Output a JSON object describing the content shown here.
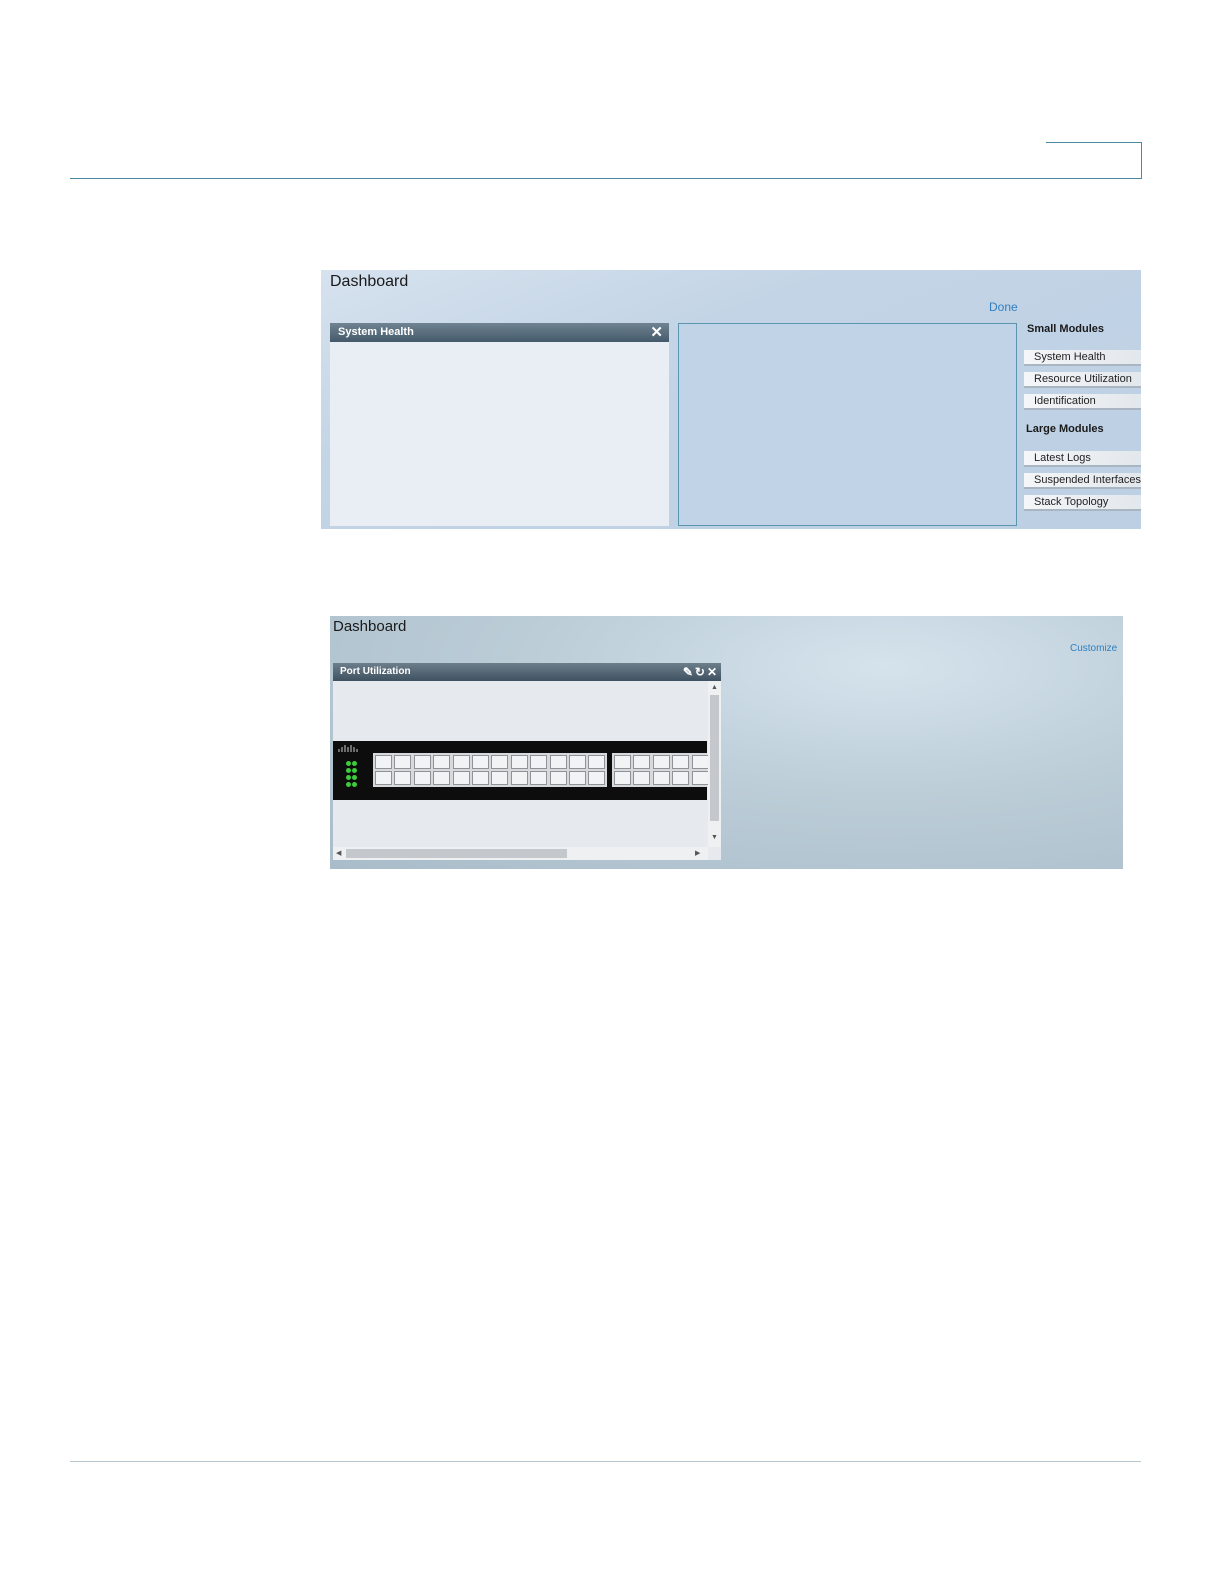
{
  "screenshot1": {
    "title": "Dashboard",
    "done_label": "Done",
    "module_title": "System Health",
    "small_modules_heading": "Small Modules",
    "small_modules": [
      "System Health",
      "Resource Utilization",
      "Identification"
    ],
    "large_modules_heading": "Large Modules",
    "large_modules": [
      "Latest Logs",
      "Suspended Interfaces",
      "Stack Topology"
    ]
  },
  "screenshot2": {
    "title": "Dashboard",
    "customize_label": "Customize",
    "module_title": "Port Utilization",
    "icons": [
      "edit-icon",
      "refresh-icon",
      "close-icon"
    ]
  },
  "colors": {
    "rule": "#4a8aa0",
    "link": "#2f7fbf",
    "module_header": "#44596a"
  }
}
